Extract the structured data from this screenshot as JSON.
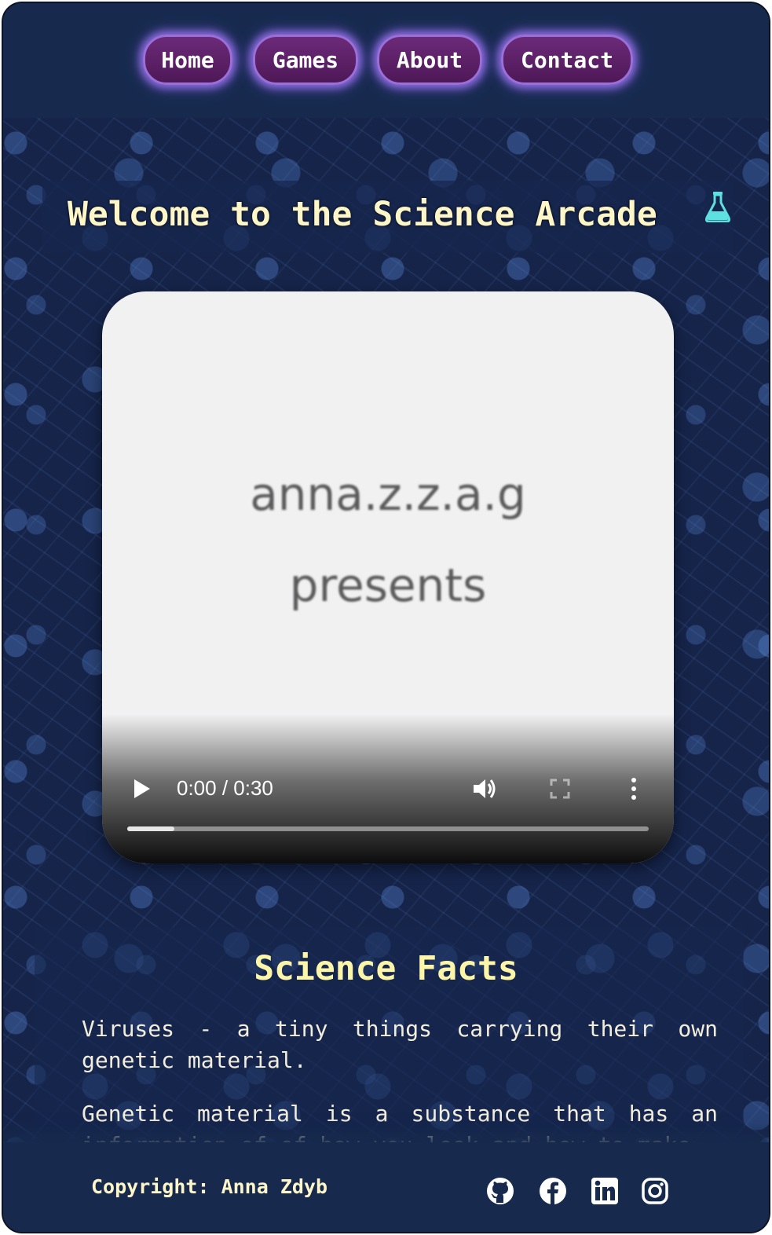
{
  "nav": {
    "items": [
      {
        "label": "Home"
      },
      {
        "label": "Games"
      },
      {
        "label": "About"
      },
      {
        "label": "Contact"
      }
    ]
  },
  "header": {
    "title": "Welcome to the Science Arcade",
    "icon": "flask-icon"
  },
  "video": {
    "line1": "anna.z.z.a.g",
    "line2": "presents",
    "time": "0:00 / 0:30",
    "progress": 0.09
  },
  "facts": {
    "title": "Science Facts",
    "paragraphs": [
      "Viruses - a tiny things carrying their own genetic material.",
      "Genetic material is a substance that has an information of of how you look and how to make"
    ]
  },
  "footer": {
    "copyright": "Copyright: Anna Zdyb",
    "social": [
      "github-icon",
      "facebook-icon",
      "linkedin-icon",
      "instagram-icon"
    ]
  },
  "colors": {
    "nav_bg": "#172a4e",
    "button": "#6c2a79",
    "button_glow": "#8d6de0",
    "title_text": "#fdf6c8",
    "flask": "#5fe0e0"
  }
}
